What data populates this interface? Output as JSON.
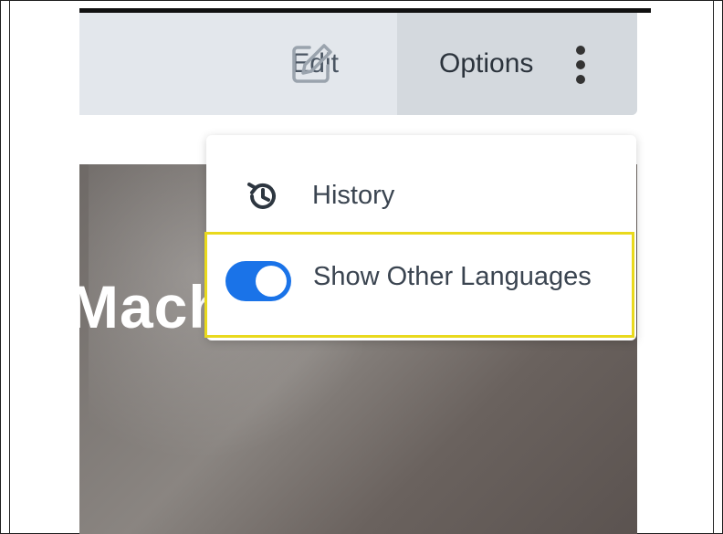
{
  "toolbar": {
    "edit_label": "Edit",
    "edit_icon": "edit-pencil-square-icon",
    "options_label": "Options",
    "options_icon": "kebab-vertical-icon"
  },
  "menu": {
    "history_label": "History",
    "history_icon": "history-clock-icon",
    "show_other_languages_label": "Show Other Languages",
    "show_other_languages_enabled": true
  },
  "hero": {
    "partial_title": "Mach"
  },
  "colors": {
    "toolbar_bg": "#e3e7ec",
    "options_bg": "#d4d9de",
    "toggle_on": "#1a73e8",
    "highlight": "#e9d91d"
  }
}
